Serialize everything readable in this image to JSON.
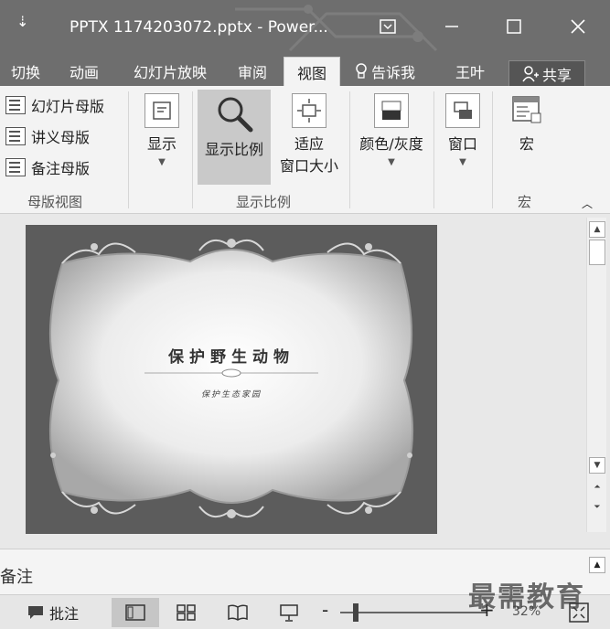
{
  "titlebar": {
    "qat_symbol": "⇣",
    "doc_title": "PPTX 1174203072.pptx - Power...",
    "buttons": [
      "ribbon-display-icon",
      "minimize-icon",
      "maximize-icon",
      "close-icon"
    ]
  },
  "tabs": {
    "items": [
      "切换",
      "动画",
      "幻灯片放映",
      "审阅",
      "视图"
    ],
    "active": "视图",
    "tell_me": "告诉我",
    "user": "王叶",
    "share": "共享"
  },
  "ribbon": {
    "master_views": {
      "items": [
        "幻灯片母版",
        "讲义母版",
        "备注母版"
      ],
      "label": "母版视图"
    },
    "show": {
      "label": "显示"
    },
    "zoom_group": {
      "zoom": "显示比例",
      "fit_line1": "适应",
      "fit_line2": "窗口大小",
      "label": "显示比例"
    },
    "color": {
      "label": "颜色/灰度"
    },
    "window": {
      "label": "窗口"
    },
    "macros": {
      "button": "宏",
      "label": "宏"
    }
  },
  "slide": {
    "title": "保护野生动物",
    "subtitle": "保护生态家园"
  },
  "notes": {
    "label": "备注"
  },
  "status": {
    "comments": "批注",
    "zoom_minus": "-",
    "zoom_plus": "+",
    "zoom_pct": "32%"
  },
  "watermark": "最需教育",
  "colors": {
    "title_bar": "#6e6e6e",
    "ribbon_bg": "#f3f3f3",
    "slide_bg": "#5c5c5c",
    "slide_panel": "#e8e8e8"
  }
}
